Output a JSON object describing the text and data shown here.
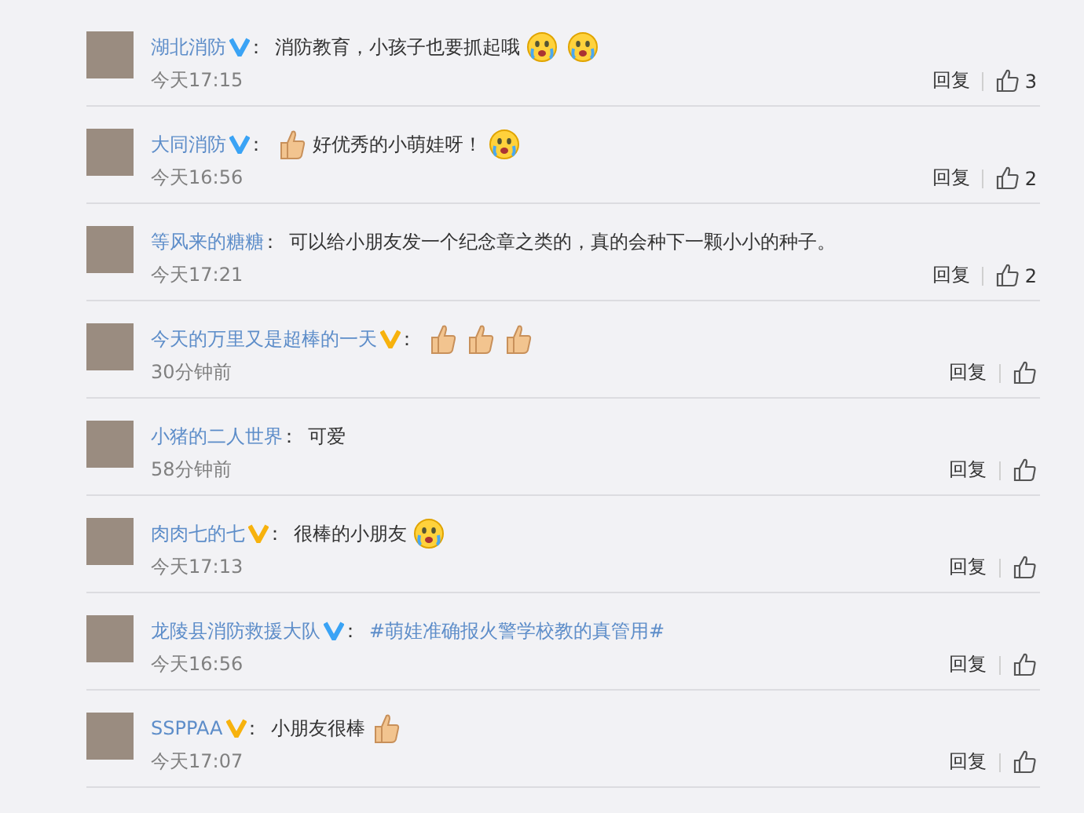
{
  "comments": [
    {
      "name": "湖北消防",
      "verified": true,
      "color": "#3aa3f5",
      "colon": "：",
      "content": [
        {
          "kind": "text",
          "text": "消防教育，小孩子也要抓起哦"
        },
        {
          "kind": "face"
        },
        {
          "kind": "face"
        }
      ],
      "time": "今天17:15",
      "reply": "回复",
      "likes": "3"
    },
    {
      "name": "大同消防",
      "verified": true,
      "color": "#3aa3f5",
      "colon": "：",
      "content": [
        {
          "kind": "thumb"
        },
        {
          "kind": "text",
          "text": "好优秀的小萌娃呀！"
        },
        {
          "kind": "face"
        }
      ],
      "time": "今天16:56",
      "reply": "回复",
      "likes": "2"
    },
    {
      "name": "等风来的糖糖",
      "verified": false,
      "colon": "：",
      "content": [
        {
          "kind": "text",
          "text": "可以给小朋友发一个纪念章之类的，真的会种下一颗小小的种子。"
        }
      ],
      "time": "今天17:21",
      "reply": "回复",
      "likes": "2"
    },
    {
      "name": "今天的万里又是超棒的一天",
      "verified": true,
      "color": "#f7b20d",
      "colon": "：",
      "content": [
        {
          "kind": "thumb"
        },
        {
          "kind": "thumb"
        },
        {
          "kind": "thumb"
        }
      ],
      "time": "30分钟前",
      "reply": "回复"
    },
    {
      "name": "小猪的二人世界",
      "verified": false,
      "colon": "：",
      "content": [
        {
          "kind": "text",
          "text": "可爱"
        }
      ],
      "time": "58分钟前",
      "reply": "回复"
    },
    {
      "name": "肉肉七的七",
      "verified": true,
      "color": "#f7b20d",
      "colon": "：",
      "content": [
        {
          "kind": "text",
          "text": "很棒的小朋友"
        },
        {
          "kind": "face"
        }
      ],
      "time": "今天17:13",
      "reply": "回复"
    },
    {
      "name": "龙陵县消防救援大队",
      "verified": true,
      "color": "#3aa3f5",
      "colon": "：",
      "content": [
        {
          "kind": "link",
          "text": "#萌娃准确报火警学校教的真管用#"
        }
      ],
      "time": "今天16:56",
      "reply": "回复"
    },
    {
      "name": "SSPPAA",
      "verified": true,
      "color": "#f7b20d",
      "colon": "：",
      "content": [
        {
          "kind": "text",
          "text": "小朋友很棒"
        },
        {
          "kind": "thumb"
        }
      ],
      "time": "今天17:07",
      "reply": "回复"
    }
  ]
}
